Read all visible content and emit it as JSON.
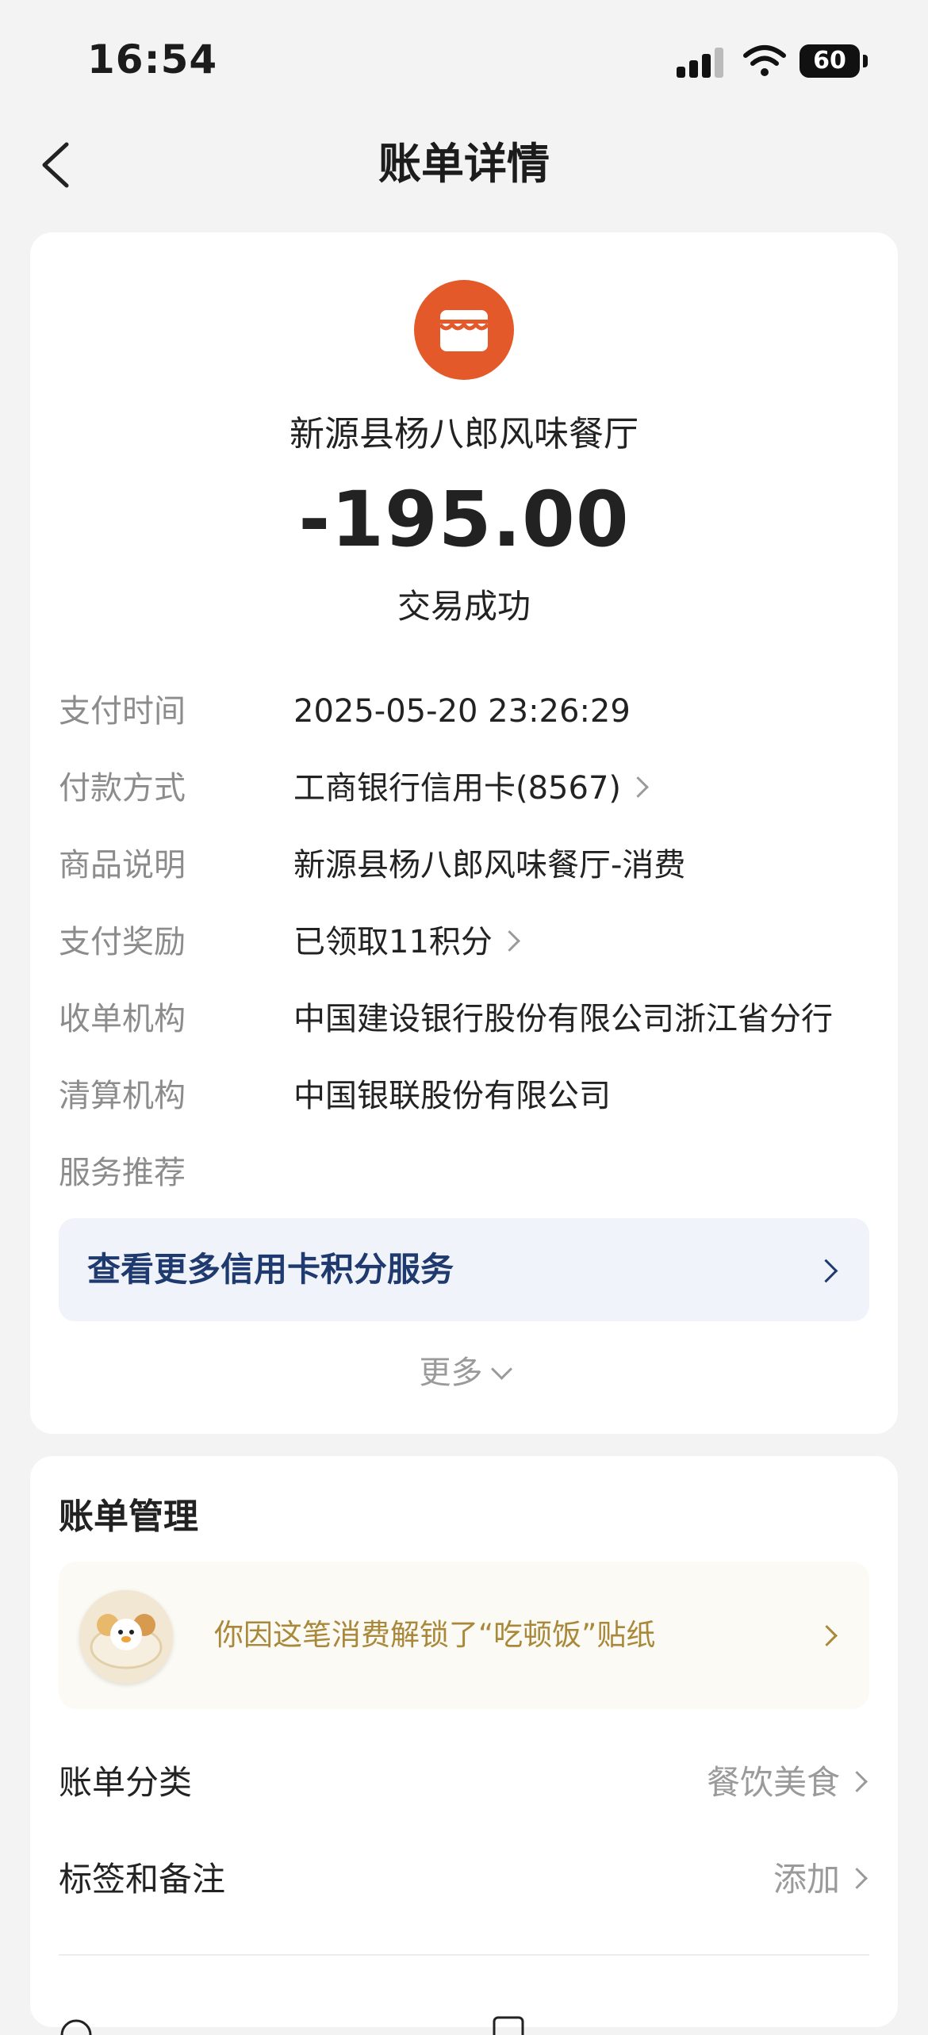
{
  "status_bar": {
    "time": "16:54",
    "battery": "60"
  },
  "nav": {
    "title": "账单详情"
  },
  "transaction": {
    "merchant": "新源县杨八郎风味餐厅",
    "amount": "-195.00",
    "status": "交易成功"
  },
  "details": [
    {
      "label": "支付时间",
      "value": "2025-05-20 23:26:29"
    },
    {
      "label": "付款方式",
      "value": "工商银行信用卡(8567)"
    },
    {
      "label": "商品说明",
      "value": "新源县杨八郎风味餐厅-消费"
    },
    {
      "label": "支付奖励",
      "value": "已领取11积分"
    },
    {
      "label": "收单机构",
      "value": "中国建设银行股份有限公司浙江省分行"
    },
    {
      "label": "清算机构",
      "value": "中国银联股份有限公司"
    },
    {
      "label": "服务推荐",
      "value": ""
    }
  ],
  "promo": {
    "text": "查看更多信用卡积分服务"
  },
  "more": {
    "label": "更多"
  },
  "bill_management": {
    "title": "账单管理",
    "sticker_text": "你因这笔消费解锁了“吃顿饭”贴纸",
    "rows": [
      {
        "label": "账单分类",
        "value": "餐饮美食"
      },
      {
        "label": "标签和备注",
        "value": "添加"
      }
    ]
  },
  "colors": {
    "merchant_icon": "#e4592a",
    "promo_text": "#1f3a6e",
    "promo_bg": "#f1f3fa",
    "sticker_text": "#a9883a"
  }
}
